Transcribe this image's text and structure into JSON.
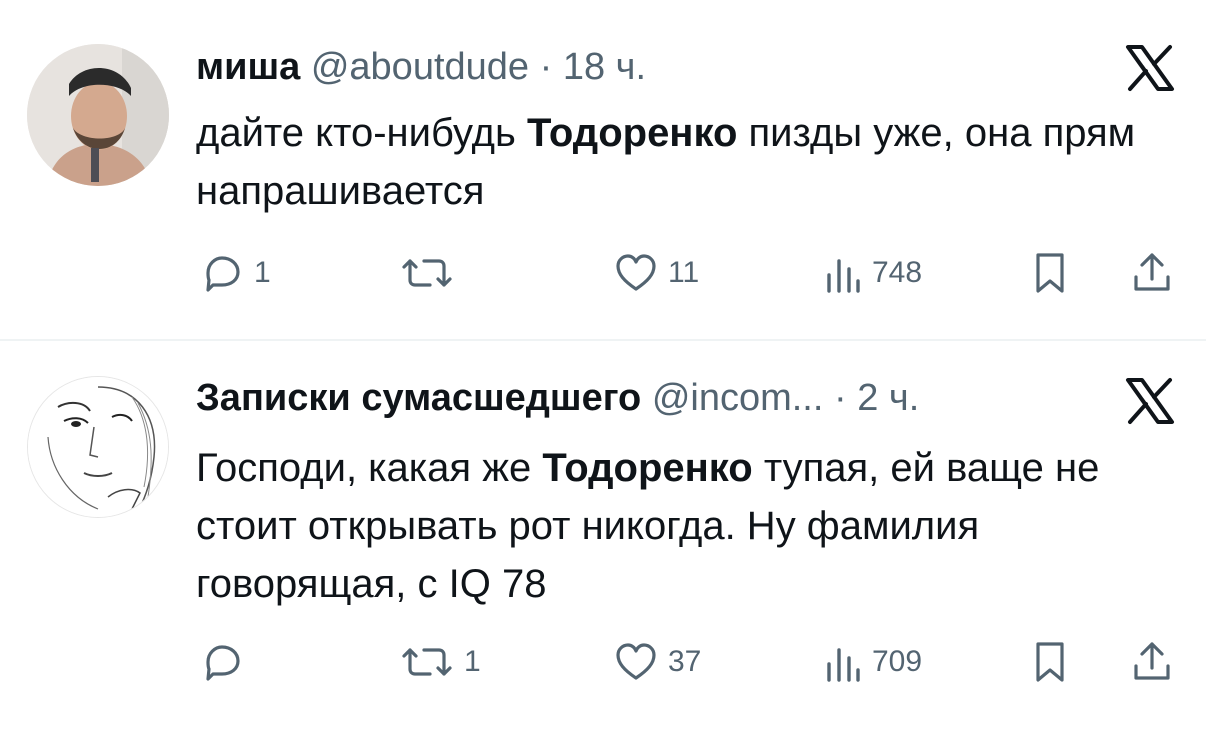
{
  "tweets": [
    {
      "author_name": "миша",
      "handle": "@aboutdude",
      "separator": "·",
      "time": "18 ч.",
      "text_parts": [
        "дайте кто-нибудь ",
        "Тодоренко",
        " пизды уже, она прям напрашивается"
      ],
      "actions": {
        "replies": "1",
        "retweets": "",
        "likes": "11",
        "views": "748"
      }
    },
    {
      "author_name": "Записки сумасшедшего",
      "handle": "@incom...",
      "separator": "·",
      "time": "2 ч.",
      "text_parts": [
        "Господи, какая же ",
        "Тодоренко",
        " тупая, ей ваще не стоит открывать рот никогда. Ну фамилия говорящая, с IQ 78"
      ],
      "actions": {
        "replies": "",
        "retweets": "1",
        "likes": "37",
        "views": "709"
      }
    }
  ],
  "icons": [
    "reply-icon",
    "retweet-icon",
    "like-icon",
    "views-icon",
    "bookmark-icon",
    "share-icon",
    "x-logo-icon"
  ],
  "colors": {
    "text": "#0f1419",
    "secondary": "#536471",
    "divider": "#eff3f4"
  }
}
